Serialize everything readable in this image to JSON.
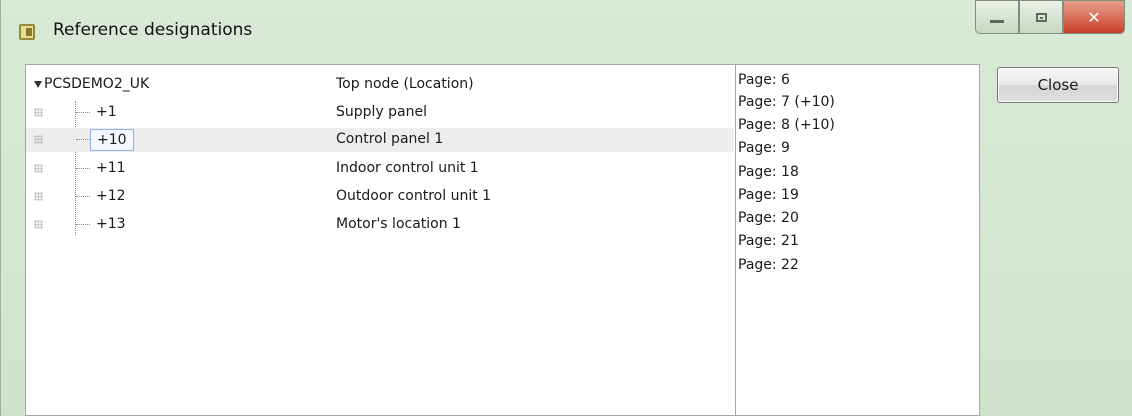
{
  "window": {
    "title": "Reference designations"
  },
  "tree": {
    "root": {
      "label": "PCSDEMO2_UK",
      "description": "Top node  (Location)"
    },
    "children": [
      {
        "label": "+1",
        "description": "Supply panel"
      },
      {
        "label": "+10",
        "description": "Control panel 1"
      },
      {
        "label": "+11",
        "description": "Indoor control unit 1"
      },
      {
        "label": "+12",
        "description": "Outdoor control unit 1"
      },
      {
        "label": "+13",
        "description": "Motor's location 1"
      }
    ]
  },
  "pages": [
    "Page: 6",
    "Page: 7 (+10)",
    "Page: 8 (+10)",
    "Page: 9",
    "Page: 18",
    "Page: 19",
    "Page: 20",
    "Page: 21",
    "Page: 22"
  ],
  "buttons": {
    "close_label": "Close"
  },
  "icons": {
    "app": "window-icon",
    "minimize": "minimize-icon",
    "maximize": "maximize-icon",
    "close": "close-icon",
    "expander": "tree-expander-icon",
    "grip": "grip-icon"
  },
  "colors": {
    "title_bar": "#d9ead6",
    "close_window_button": "#c7412b",
    "selection_row": "#eeeeee",
    "focus_border": "#8db2e3"
  }
}
